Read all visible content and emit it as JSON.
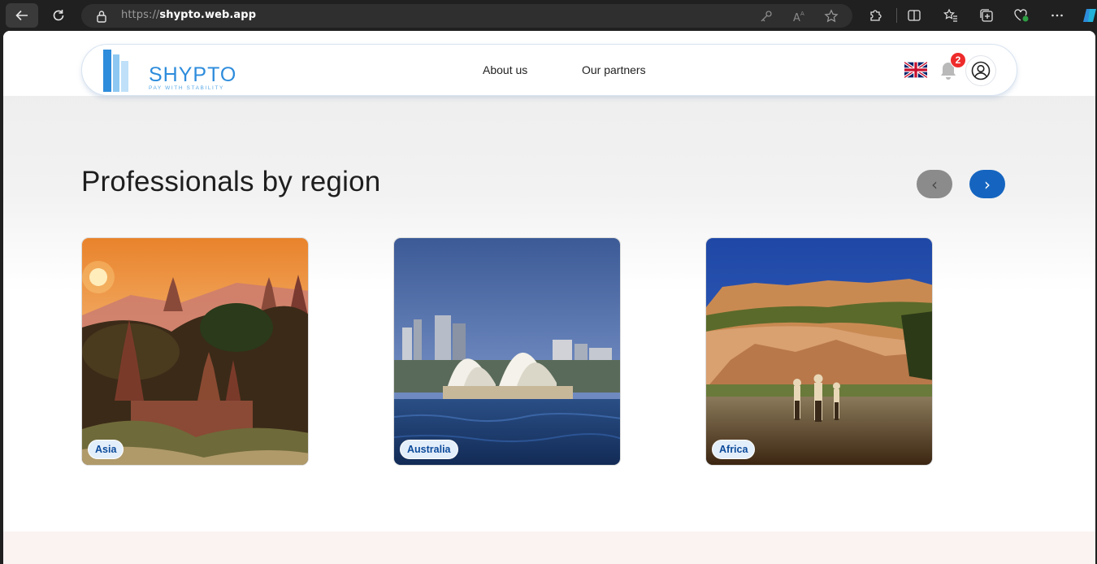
{
  "browser": {
    "url_prefix": "https://",
    "url_host": "shypto.web.app"
  },
  "header": {
    "logo_text": "SHYPTO",
    "logo_tagline": "PAY WITH STABILITY",
    "nav": [
      "About us",
      "Our partners"
    ],
    "notification_count": "2",
    "language": "English (UK flag)"
  },
  "section": {
    "title": "Professionals by region",
    "prev_label": "‹",
    "next_label": "›"
  },
  "regions": [
    {
      "label": "Asia",
      "image": "temples-at-sunset"
    },
    {
      "label": "Australia",
      "image": "sydney-opera-house-skyline"
    },
    {
      "label": "Africa",
      "image": "river-cliffs-walkers"
    }
  ],
  "colors": {
    "accent": "#1565c0",
    "badge": "#ee2b2b",
    "logo": "#2d8cdc"
  }
}
